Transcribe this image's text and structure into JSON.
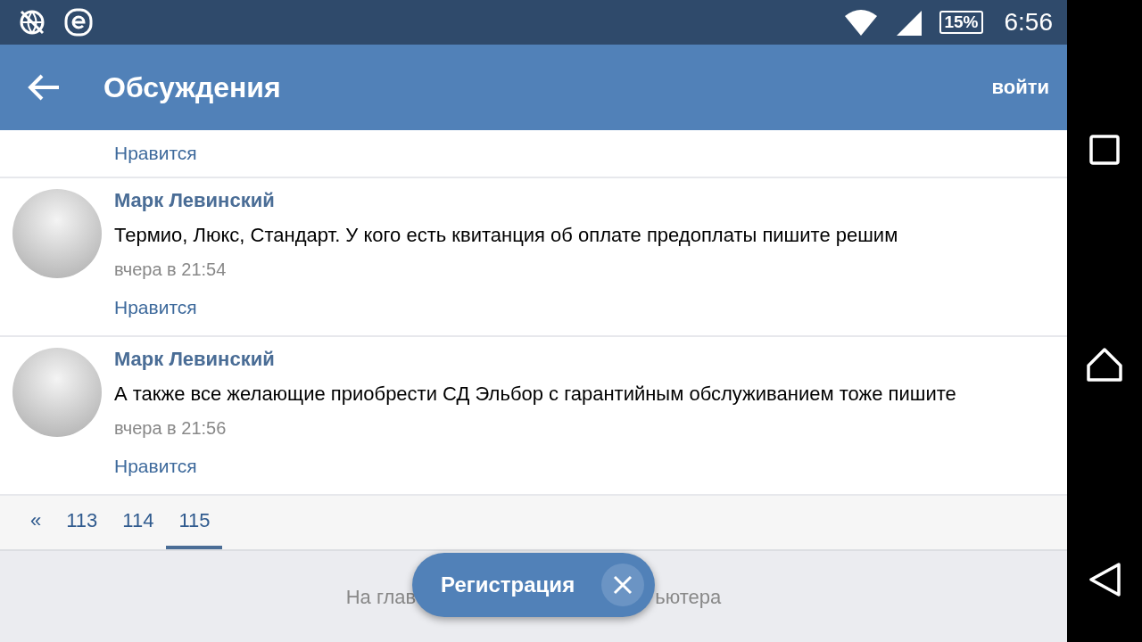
{
  "status_bar": {
    "battery": "15%",
    "time": "6:56"
  },
  "app_bar": {
    "title": "Обсуждения",
    "action": "войти"
  },
  "comments": [
    {
      "like": "Нравится"
    },
    {
      "author": "Марк Левинский",
      "text": "Термио, Люкс, Стандарт. У кого есть квитанция об оплате предоплаты пишите решим",
      "time": "вчера в 21:54",
      "like": "Нравится"
    },
    {
      "author": "Марк Левинский",
      "text": "А также все желающие приобрести СД Эльбор с гарантийным обслуживанием тоже пишите",
      "time": "вчера в 21:56",
      "like": "Нравится"
    }
  ],
  "pagination": [
    {
      "label": "«",
      "selected": false
    },
    {
      "label": "113",
      "selected": false
    },
    {
      "label": "114",
      "selected": false
    },
    {
      "label": "115",
      "selected": true
    }
  ],
  "footer": {
    "texts": [
      "На глав",
      "ьютера"
    ],
    "register_button": "Регистрация"
  }
}
